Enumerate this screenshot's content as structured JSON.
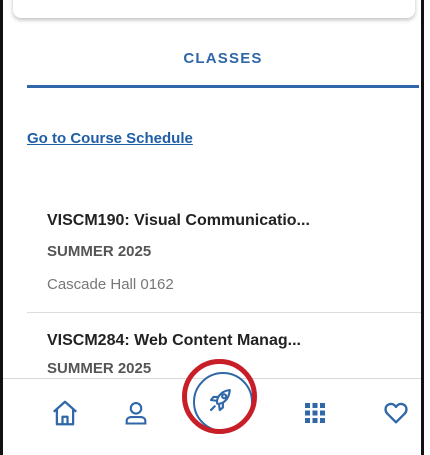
{
  "tab": {
    "label": "CLASSES"
  },
  "schedule_link": "Go to Course Schedule",
  "classes": [
    {
      "name": "VISCM190: Visual Communicatio...",
      "term": "SUMMER 2025",
      "room": "Cascade Hall 0162"
    },
    {
      "name": "VISCM284: Web Content Manag...",
      "term": "SUMMER 2025"
    }
  ],
  "nav": {
    "items": [
      {
        "icon": "home-icon"
      },
      {
        "icon": "profile-icon"
      },
      {
        "icon": "rocket-icon"
      },
      {
        "icon": "apps-grid-icon"
      },
      {
        "icon": "heart-icon"
      }
    ]
  },
  "colors": {
    "accent": "#2f67a8",
    "highlight": "#c81e28"
  }
}
